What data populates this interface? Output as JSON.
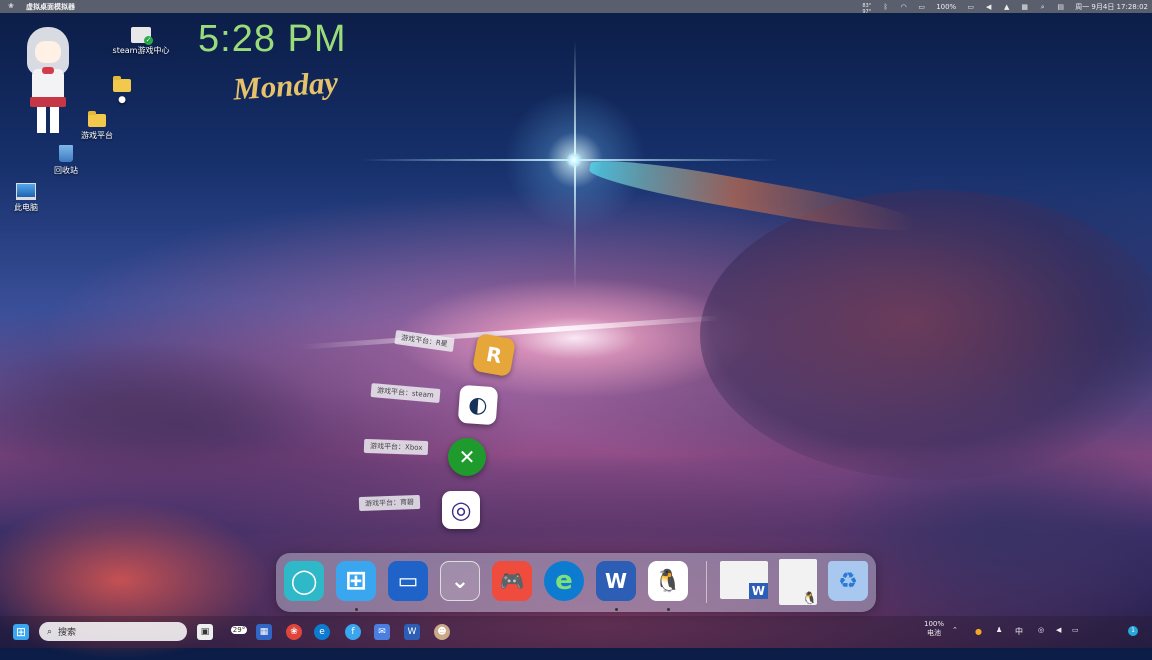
{
  "menubar": {
    "app_title": "虚拟桌面模拟器",
    "weather_top": "83°",
    "weather_bottom": "97°",
    "battery": "100%",
    "datetime": "周一 9月4日 17:28:02"
  },
  "desktop": {
    "icons": [
      {
        "name": "steam游戏中心",
        "icon": "printer-check-icon"
      },
      {
        "name": "游戏平台",
        "icon": "folder-icon"
      },
      {
        "name": "回收站",
        "icon": "recycle-bin-icon"
      },
      {
        "name": "此电脑",
        "icon": "monitor-icon"
      }
    ]
  },
  "clock_widget": {
    "time": "5:28 PM",
    "day": "Monday"
  },
  "launcher": {
    "items": [
      {
        "label": "游戏平台：R星",
        "glyph": "R",
        "color": "#e6a63a"
      },
      {
        "label": "游戏平台：steam",
        "glyph": "◐",
        "color": "#16305a"
      },
      {
        "label": "游戏平台：Xbox",
        "glyph": "✕",
        "color": "#1f9b2e"
      },
      {
        "label": "游戏平台：育碧",
        "glyph": "◎",
        "color": "#ffffff"
      }
    ]
  },
  "dock": {
    "items": [
      {
        "name": "circle-app",
        "glyph": "◯",
        "bg": "#2fb9c8",
        "running": false
      },
      {
        "name": "windows-start",
        "glyph": "⊞",
        "bg": "#3aa6f0",
        "running": true
      },
      {
        "name": "desktop-app",
        "glyph": "▭",
        "bg": "#1f63c9",
        "running": false
      },
      {
        "name": "chevron-app",
        "glyph": "⌄",
        "bg": "rgba(255,255,255,0.15)",
        "running": false
      },
      {
        "name": "game-center",
        "glyph": "🎮",
        "bg": "#f04c3e",
        "running": false
      },
      {
        "name": "edge",
        "glyph": "e",
        "bg": "#0d7bd0",
        "running": false
      },
      {
        "name": "word",
        "glyph": "W",
        "bg": "#2b5eb4",
        "running": true
      },
      {
        "name": "qq",
        "glyph": "🐧",
        "bg": "#ffffff",
        "running": true
      },
      {
        "name": "document-window-1",
        "glyph": "W",
        "bg": "#f2f2f2",
        "running": false
      },
      {
        "name": "document-window-2",
        "glyph": "🐧",
        "bg": "#f2f2f2",
        "running": false
      },
      {
        "name": "recycle-bin",
        "glyph": "♻",
        "bg": "#a9c8f0",
        "running": false
      }
    ]
  },
  "taskbar": {
    "search_placeholder": "搜索",
    "weather_badge": "29°",
    "tray_battery": "100%",
    "tray_label": "电池",
    "tray_ime": "中",
    "notification_count": "1"
  }
}
